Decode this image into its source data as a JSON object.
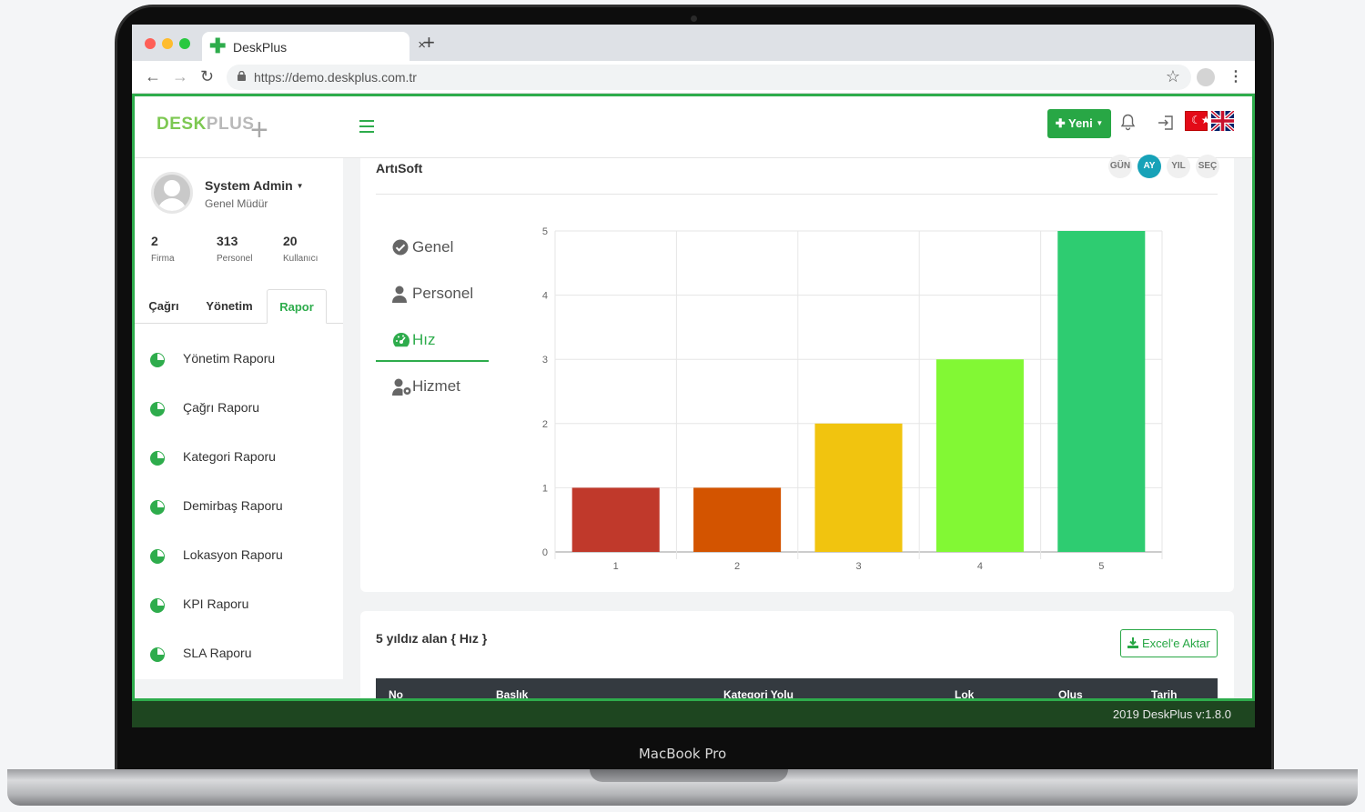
{
  "device": {
    "label": "MacBook Pro"
  },
  "browser": {
    "tab_title": "DeskPlus",
    "tab_close": "×",
    "new_tab": "+",
    "url": "https://demo.deskplus.com.tr"
  },
  "app": {
    "logo_part1": "DESK",
    "logo_part2": "PLUS",
    "new_button_label": "Yeni",
    "footer": "2019 DeskPlus v:1.8.0"
  },
  "user": {
    "name": "System Admin",
    "title": "Genel Müdür",
    "stats": [
      {
        "value": "2",
        "label": "Firma"
      },
      {
        "value": "313",
        "label": "Personel"
      },
      {
        "value": "20",
        "label": "Kullanıcı"
      }
    ]
  },
  "sidebar": {
    "tabs": [
      "Çağrı",
      "Yönetim",
      "Rapor"
    ],
    "active_tab": "Rapor",
    "items": [
      {
        "label": "Yönetim Raporu"
      },
      {
        "label": "Çağrı Raporu"
      },
      {
        "label": "Kategori Raporu"
      },
      {
        "label": "Demirbaş Raporu"
      },
      {
        "label": "Lokasyon Raporu"
      },
      {
        "label": "KPI Raporu"
      },
      {
        "label": "SLA Raporu"
      }
    ]
  },
  "report": {
    "title": "ArtıSoft",
    "periods": [
      "GÜN",
      "AY",
      "YIL",
      "SEÇ"
    ],
    "active_period": "AY",
    "tabs": [
      {
        "label": "Genel",
        "icon": "check-circle-icon"
      },
      {
        "label": "Personel",
        "icon": "user-icon"
      },
      {
        "label": "Hız",
        "icon": "speedometer-icon"
      },
      {
        "label": "Hizmet",
        "icon": "user-gear-icon"
      }
    ],
    "active_tab": "Hız"
  },
  "chart_data": {
    "type": "bar",
    "categories": [
      "1",
      "2",
      "3",
      "4",
      "5"
    ],
    "values": [
      1,
      1,
      2,
      3,
      5
    ],
    "colors": [
      "#c0392b",
      "#d35400",
      "#f1c40f",
      "#82f834",
      "#2ecc71"
    ],
    "ylim": [
      0,
      5
    ],
    "yticks": [
      "0",
      "1",
      "2",
      "3",
      "4",
      "5"
    ],
    "grid": true
  },
  "table_section": {
    "title": "5 yıldız alan { Hız }",
    "excel_button": "Excel'e Aktar",
    "headers": [
      "No",
      "Başlık",
      "Kategori Yolu",
      "Lok",
      "Oluş",
      "Tarih"
    ]
  },
  "colors": {
    "accent": "#2eac4c",
    "info": "#17a2b8",
    "footer": "#1e4620"
  }
}
